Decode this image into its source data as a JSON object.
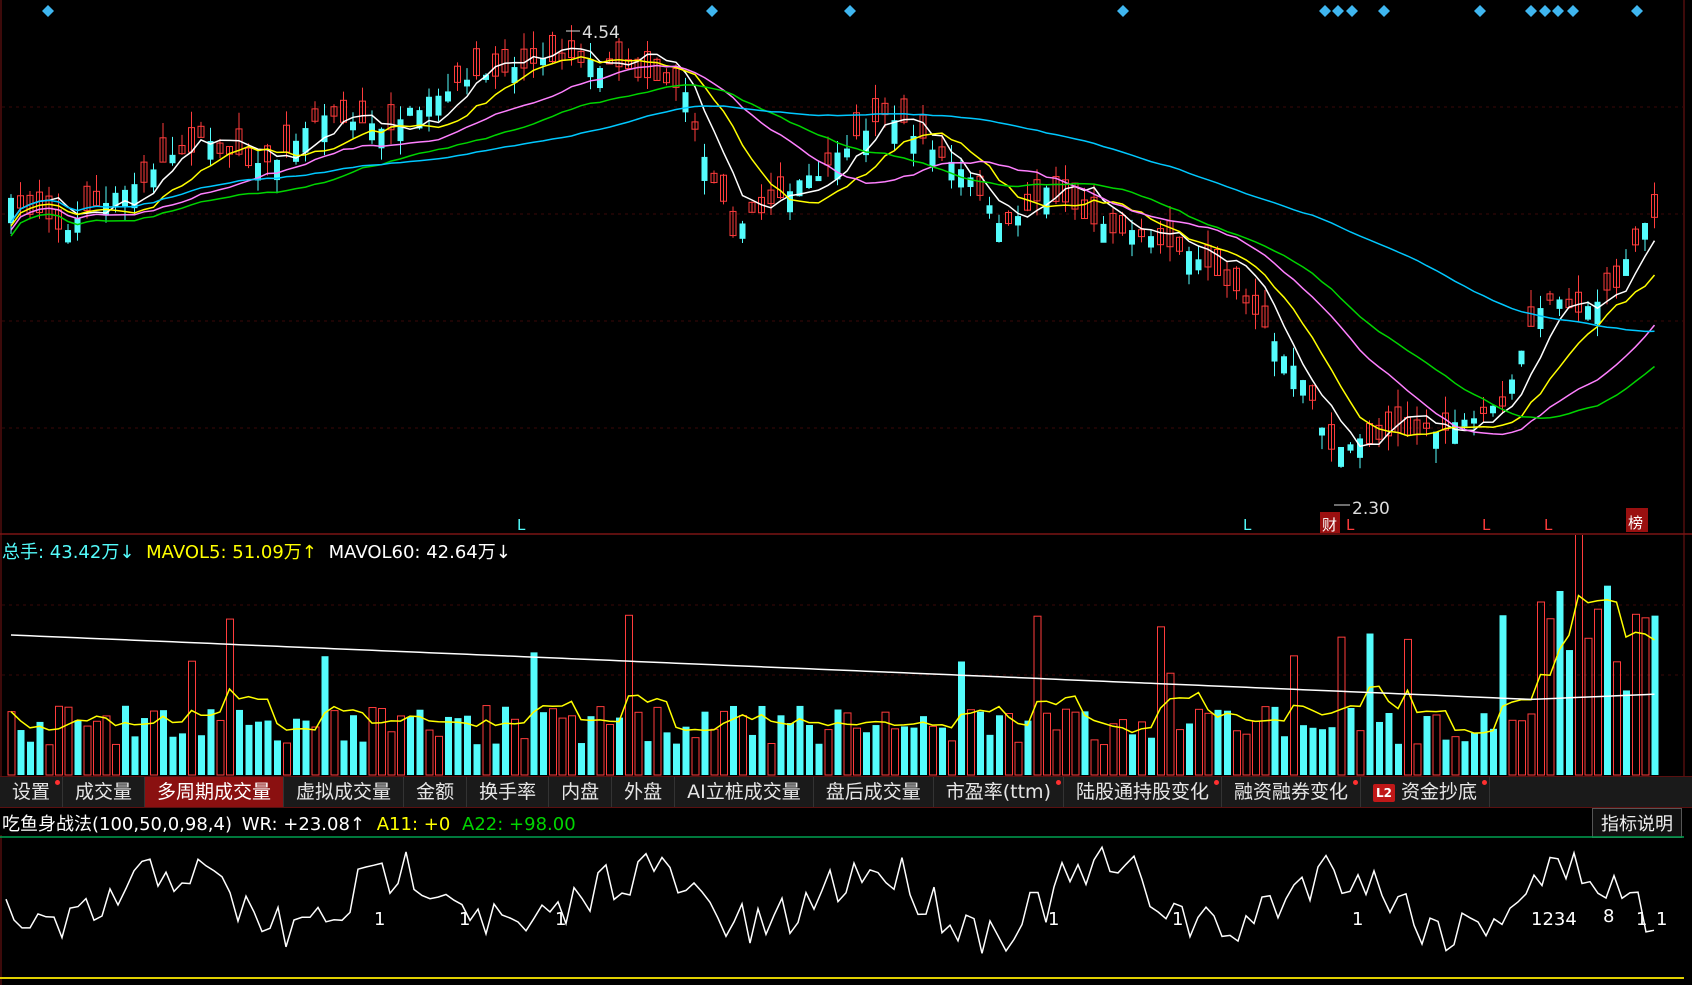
{
  "price_chart": {
    "high_label": "4.54",
    "low_label": "2.30",
    "signal_marks": [
      "L",
      "L",
      "L",
      "L",
      "L",
      "L"
    ],
    "finance_badge": "财",
    "rank_badge": "榜",
    "colors": {
      "up": "#ff3c3c",
      "down": "#54fcfc",
      "ma5": "#ffffff",
      "ma10": "#ffff00",
      "ma20": "#ff80ff",
      "ma30": "#00d400",
      "ma60": "#00c8ff"
    }
  },
  "volume": {
    "total_label": "总手: ",
    "total_value": "43.42万↓",
    "mavol5_label": "MAVOL5: ",
    "mavol5_value": "51.09万↑",
    "mavol60_label": "MAVOL60: ",
    "mavol60_value": "42.64万↓"
  },
  "tabs": [
    {
      "label": "设置",
      "active": false,
      "dot": true
    },
    {
      "label": "成交量",
      "active": false,
      "dot": false
    },
    {
      "label": "多周期成交量",
      "active": true,
      "dot": false
    },
    {
      "label": "虚拟成交量",
      "active": false,
      "dot": false
    },
    {
      "label": "金额",
      "active": false,
      "dot": false
    },
    {
      "label": "换手率",
      "active": false,
      "dot": false
    },
    {
      "label": "内盘",
      "active": false,
      "dot": false
    },
    {
      "label": "外盘",
      "active": false,
      "dot": false
    },
    {
      "label": "AI立桩成交量",
      "active": false,
      "dot": false
    },
    {
      "label": "盘后成交量",
      "active": false,
      "dot": false
    },
    {
      "label": "市盈率(ttm)",
      "active": false,
      "dot": true
    },
    {
      "label": "陆股通持股变化",
      "active": false,
      "dot": true
    },
    {
      "label": "融资融券变化",
      "active": false,
      "dot": true
    },
    {
      "label": "资金抄底",
      "active": false,
      "dot": true,
      "badge": "L2"
    }
  ],
  "indicator": {
    "name": "吃鱼身战法(100,50,0,98,4)",
    "wr_label": "WR: ",
    "wr_value": "+23.08↑",
    "a11_label": "A11: ",
    "a11_value": "+0",
    "a22_label": "A22: ",
    "a22_value": "+98.00",
    "help_button": "指标说明",
    "signal_labels": [
      "1",
      "1",
      "1",
      "1",
      "1",
      "1",
      "1234",
      "8",
      "1",
      "1"
    ]
  }
}
